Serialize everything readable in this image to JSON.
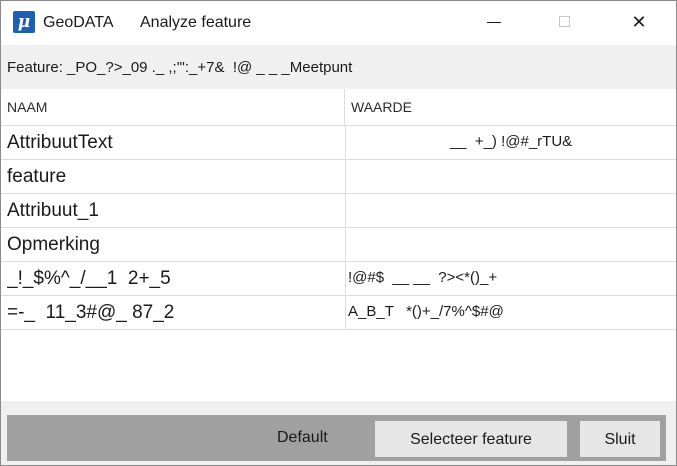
{
  "titlebar": {
    "app_icon_glyph": "μ",
    "app_name": "GeoDATA",
    "window_title": "Analyze feature",
    "close_glyph": "✕"
  },
  "feature_bar": {
    "text": "Feature: _PO_?>_09 ._ ,;'\":_+7&  !@ _ _ _Meetpunt"
  },
  "grid": {
    "headers": [
      "NAAM",
      "WAARDE"
    ],
    "rows": [
      {
        "name": "AttribuutText",
        "value": "__  +_) !@#_rTU&"
      },
      {
        "name": "feature",
        "value": ""
      },
      {
        "name": "Attribuut_1",
        "value": ""
      },
      {
        "name": "Opmerking",
        "value": ""
      },
      {
        "name": "_!_$%^_/__1  2+_5",
        "value": "!@#$  __ __  ?><*()_+"
      },
      {
        "name": "=-_  11_3#@_ 87_2",
        "value": "A_B_T   *()+_/7%^$#@"
      }
    ]
  },
  "footer": {
    "default_label": "Default",
    "select_button": "Selecteer feature",
    "close_button": "Sluit"
  },
  "colors": {
    "app_icon": "#1e5fb4",
    "feature_bar_bg": "#f0f0f0",
    "footer_bar": "#a0a0a0",
    "button_bg": "#e6e6e6"
  }
}
